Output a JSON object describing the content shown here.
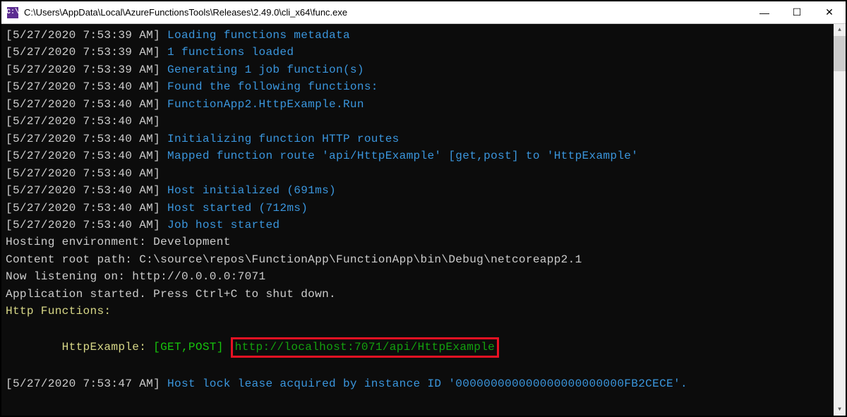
{
  "window": {
    "title": "C:\\Users\\AppData\\Local\\AzureFunctionsTools\\Releases\\2.49.0\\cli_x64\\func.exe",
    "icon_label": "C:\\"
  },
  "controls": {
    "minimize": "—",
    "maximize": "☐",
    "close": "✕"
  },
  "scroll": {
    "up": "▲",
    "down": "▼"
  },
  "log": {
    "lines": [
      {
        "ts": "[5/27/2020 7:53:39 AM] ",
        "msg": "Loading functions metadata",
        "cls": "cyan"
      },
      {
        "ts": "[5/27/2020 7:53:39 AM] ",
        "msg": "1 functions loaded",
        "cls": "cyan"
      },
      {
        "ts": "[5/27/2020 7:53:39 AM] ",
        "msg": "Generating 1 job function(s)",
        "cls": "cyan"
      },
      {
        "ts": "[5/27/2020 7:53:40 AM] ",
        "msg": "Found the following functions:",
        "cls": "cyan"
      },
      {
        "ts": "[5/27/2020 7:53:40 AM] ",
        "msg": "FunctionApp2.HttpExample.Run",
        "cls": "cyan"
      },
      {
        "ts": "[5/27/2020 7:53:40 AM] ",
        "msg": "",
        "cls": ""
      },
      {
        "ts": "[5/27/2020 7:53:40 AM] ",
        "msg": "Initializing function HTTP routes",
        "cls": "cyan"
      },
      {
        "ts": "[5/27/2020 7:53:40 AM] ",
        "msg": "Mapped function route 'api/HttpExample' [get,post] to 'HttpExample'",
        "cls": "cyan"
      },
      {
        "ts": "[5/27/2020 7:53:40 AM] ",
        "msg": "",
        "cls": ""
      },
      {
        "ts": "[5/27/2020 7:53:40 AM] ",
        "msg": "Host initialized (691ms)",
        "cls": "cyan"
      },
      {
        "ts": "[5/27/2020 7:53:40 AM] ",
        "msg": "Host started (712ms)",
        "cls": "cyan"
      },
      {
        "ts": "[5/27/2020 7:53:40 AM] ",
        "msg": "Job host started",
        "cls": "cyan"
      }
    ],
    "plain": [
      "Hosting environment: Development",
      "Content root path: C:\\source\\repos\\FunctionApp\\FunctionApp\\bin\\Debug\\netcoreapp2.1",
      "Now listening on: http://0.0.0.0:7071",
      "Application started. Press Ctrl+C to shut down.",
      ""
    ],
    "section_header": "Http Functions:",
    "func_line": {
      "indent": "        ",
      "name": "HttpExample: ",
      "methods": "[GET,POST] ",
      "url": "http://localhost:7071/api/HttpExample"
    },
    "tail": {
      "ts": "[5/27/2020 7:53:47 AM] ",
      "msg": "Host lock lease acquired by instance ID '000000000000000000000000FB2CECE'."
    }
  }
}
